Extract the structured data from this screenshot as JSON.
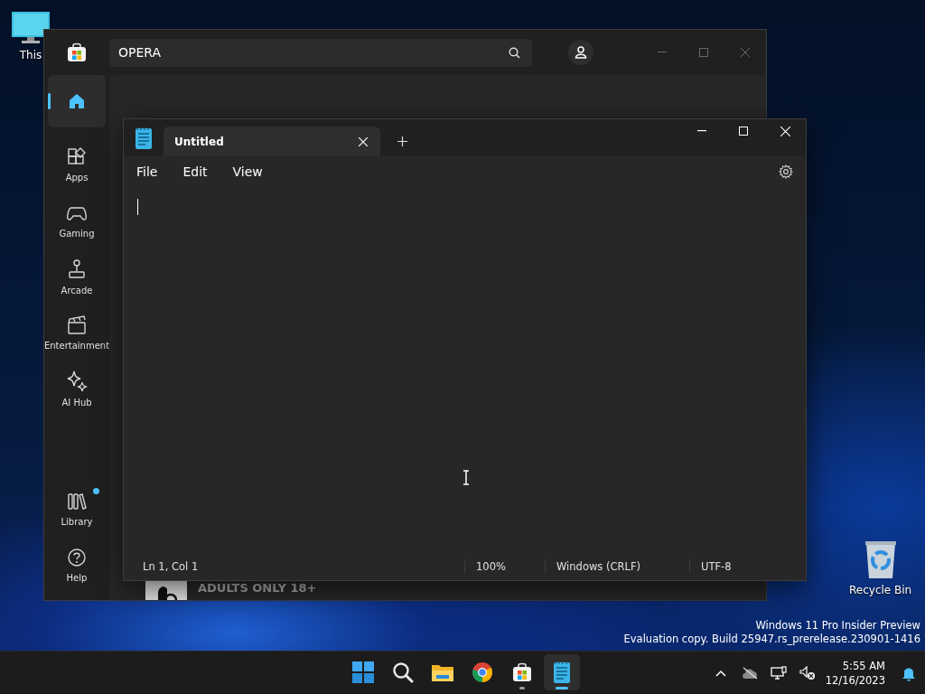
{
  "desktop": {
    "icons": [
      {
        "kind": "pc",
        "label": "This"
      },
      {
        "kind": "bin",
        "label": "Recycle Bin"
      }
    ],
    "build_info": [
      "Windows 11 Pro Insider Preview",
      "Evaluation copy. Build 25947.rs_prerelease.230901-1416"
    ]
  },
  "store_window": {
    "search": {
      "value": "OPERA"
    },
    "nav": [
      {
        "kind": "home",
        "selected": true,
        "badge": false
      },
      {
        "kind": "apps",
        "label": "Apps",
        "selected": false,
        "badge": false
      },
      {
        "kind": "gaming",
        "label": "Gaming",
        "selected": false,
        "badge": false
      },
      {
        "kind": "arcade",
        "label": "Arcade",
        "selected": false,
        "badge": false
      },
      {
        "kind": "entertainment",
        "label": "Entertainment",
        "selected": false,
        "badge": false
      },
      {
        "kind": "ai",
        "label": "AI Hub",
        "selected": false,
        "badge": false
      },
      {
        "kind": "library",
        "label": "Library",
        "selected": false,
        "badge": true
      },
      {
        "kind": "help",
        "label": "Help",
        "selected": false,
        "badge": false
      }
    ],
    "result": {
      "rating": "ADULTS ONLY 18+"
    }
  },
  "notepad": {
    "tabs": [
      {
        "title": "Untitled",
        "selected": true
      }
    ],
    "menu": [
      "File",
      "Edit",
      "View"
    ],
    "status": [
      "Ln 1, Col 1",
      "100%",
      "Windows (CRLF)",
      "UTF-8"
    ]
  },
  "taskbar": {
    "apps": [
      {
        "kind": "start",
        "running": false,
        "active": false
      },
      {
        "kind": "search",
        "running": false,
        "active": false
      },
      {
        "kind": "explorer",
        "running": false,
        "active": false
      },
      {
        "kind": "chrome",
        "running": false,
        "active": false
      },
      {
        "kind": "store",
        "running": true,
        "active": false
      },
      {
        "kind": "notepad",
        "running": true,
        "active": true
      }
    ],
    "clock": {
      "time": "5:55 AM",
      "date": "12/16/2023"
    }
  }
}
